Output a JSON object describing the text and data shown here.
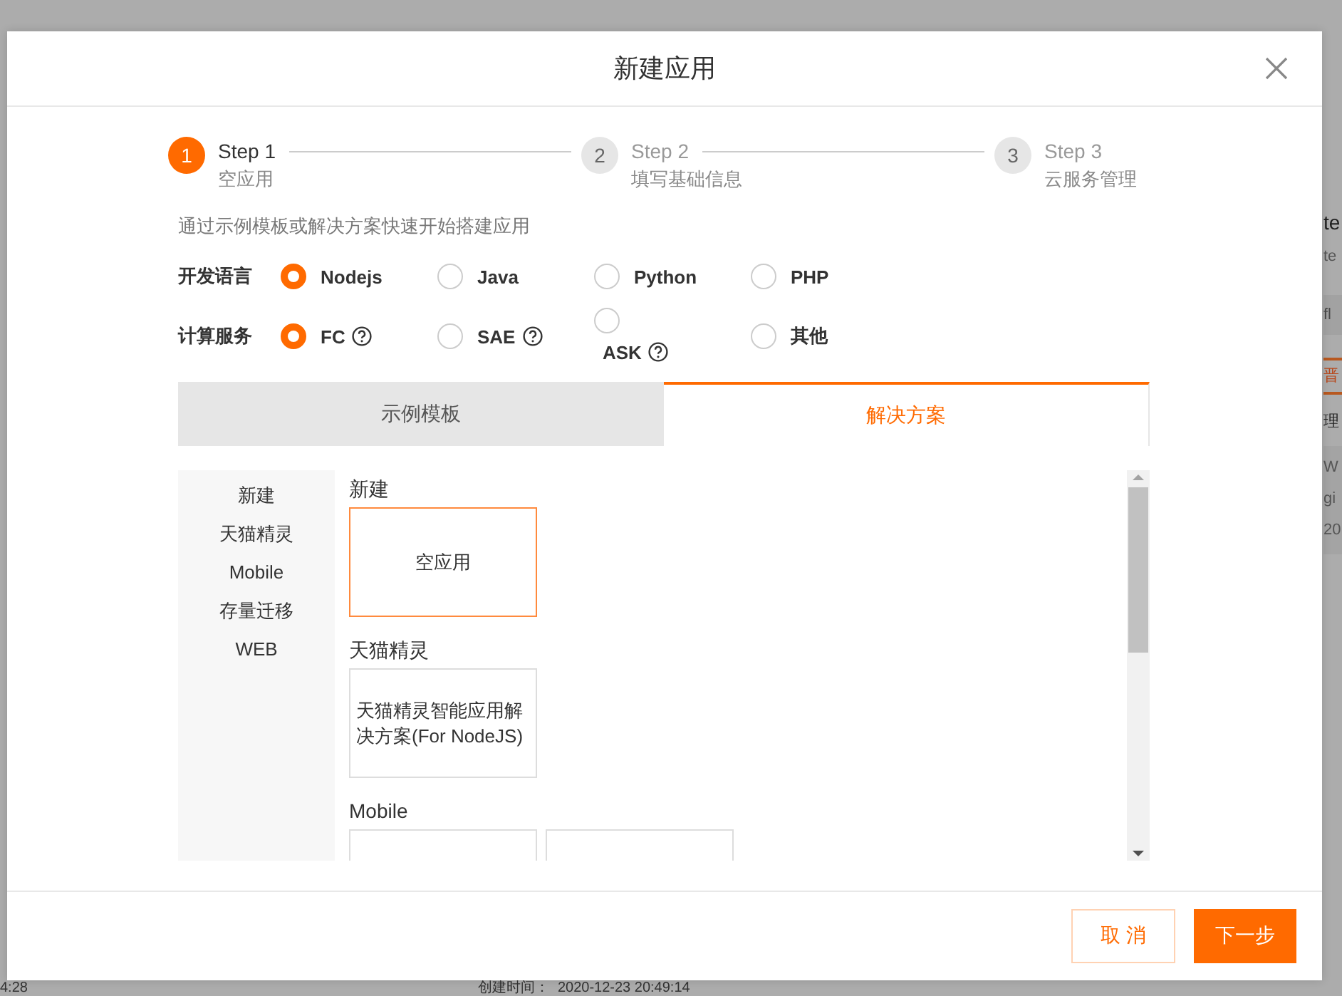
{
  "backdrop": {
    "side_lines": [
      {
        "text": "te",
        "kind": "title"
      },
      {
        "text": "te",
        "kind": "muted"
      },
      {
        "text": "fl",
        "kind": "band"
      },
      {
        "text": "晋",
        "kind": "tab"
      },
      {
        "text": "理",
        "kind": "status"
      },
      {
        "text": "W",
        "kind": "info"
      },
      {
        "text": "gi",
        "kind": "info"
      },
      {
        "text": "20",
        "kind": "info"
      }
    ],
    "bottom": {
      "time": "4:28",
      "created_label": "创建时间：",
      "created_value": "2020-12-23 20:49:14"
    }
  },
  "dialog": {
    "title": "新建应用",
    "steps": [
      {
        "number": "1",
        "title": "Step 1",
        "subtitle": "空应用",
        "selected": true
      },
      {
        "number": "2",
        "title": "Step 2",
        "subtitle": "填写基础信息",
        "selected": false
      },
      {
        "number": "3",
        "title": "Step 3",
        "subtitle": "云服务管理",
        "selected": false
      }
    ],
    "intro": "通过示例模板或解决方案快速开始搭建应用",
    "fields": [
      {
        "label": "开发语言",
        "options": [
          {
            "label": "Nodejs",
            "selected": true,
            "help": false,
            "kind": "inline"
          },
          {
            "label": "Java",
            "selected": false,
            "help": false,
            "kind": "inline"
          },
          {
            "label": "Python",
            "selected": false,
            "help": false,
            "kind": "inline"
          },
          {
            "label": "PHP",
            "selected": false,
            "help": false,
            "kind": "inline"
          }
        ]
      },
      {
        "label": "计算服务",
        "options": [
          {
            "label": "FC",
            "selected": true,
            "help": true,
            "kind": "inline"
          },
          {
            "label": "SAE",
            "selected": false,
            "help": true,
            "kind": "inline"
          },
          {
            "label": "ASK",
            "selected": false,
            "help": true,
            "kind": "stacked"
          },
          {
            "label": "其他",
            "selected": false,
            "help": false,
            "kind": "inline"
          }
        ]
      }
    ],
    "tabs": [
      {
        "label": "示例模板",
        "selected": false
      },
      {
        "label": "解决方案",
        "selected": true
      }
    ],
    "categories": [
      "新建",
      "天猫精灵",
      "Mobile",
      "存量迁移",
      "WEB"
    ],
    "sections": [
      {
        "title": "新建",
        "cards": [
          {
            "label": "空应用",
            "selected": true
          }
        ]
      },
      {
        "title": "天猫精灵",
        "cards": [
          {
            "label": "天猫精灵智能应用解决方案(For NodeJS)",
            "selected": false
          }
        ]
      },
      {
        "title": "Mobile",
        "cards": [
          {
            "selected": false
          },
          {
            "selected": false
          }
        ]
      }
    ],
    "buttons": [
      {
        "label": "取 消",
        "kind": "secondary"
      },
      {
        "label": "下一步",
        "kind": "primary"
      }
    ]
  }
}
